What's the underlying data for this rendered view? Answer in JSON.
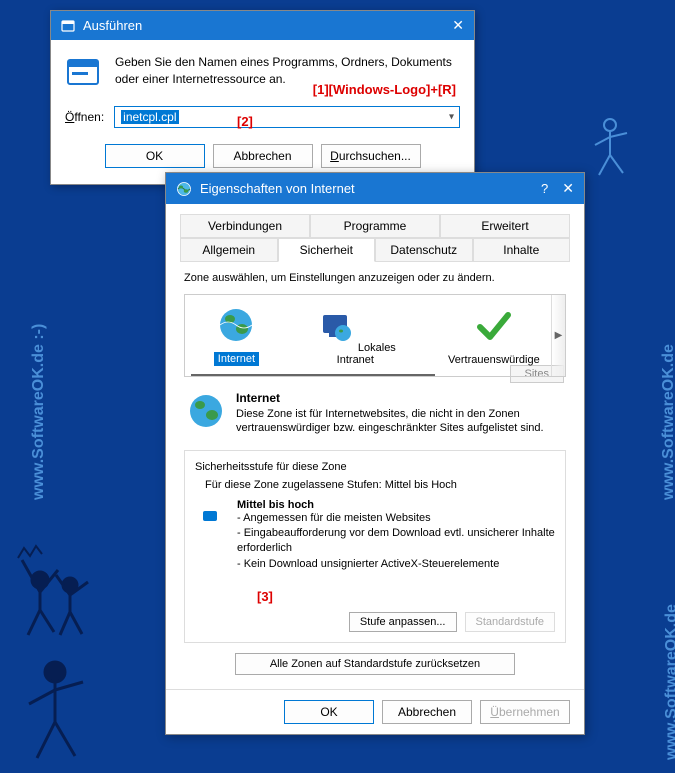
{
  "watermark": "www.SoftwareOK.de :-)",
  "run": {
    "title": "Ausführen",
    "desc": "Geben Sie den Namen eines Programms, Ordners, Dokuments oder einer Internetressource an.",
    "open_label": "Öffnen:",
    "input_value": "inetcpl.cpl",
    "ok": "OK",
    "cancel": "Abbrechen",
    "browse": "Durchsuchen...",
    "ann1": "[1][Windows-Logo]+[R]",
    "ann2": "[2]"
  },
  "inet": {
    "title": "Eigenschaften von Internet",
    "tabs_row1": [
      "Verbindungen",
      "Programme",
      "Erweitert"
    ],
    "tabs_row2": [
      "Allgemein",
      "Sicherheit",
      "Datenschutz",
      "Inhalte"
    ],
    "active_tab": "Sicherheit",
    "zone_desc": "Zone auswählen, um Einstellungen anzuzeigen oder zu ändern.",
    "zones": [
      {
        "label": "Internet",
        "selected": true
      },
      {
        "label": "Lokales Intranet",
        "selected": false
      },
      {
        "label": "Vertrauenswürdige",
        "selected": false
      }
    ],
    "sites_btn": "Sites",
    "sel_title": "Internet",
    "sel_desc": "Diese Zone ist für Internetwebsites, die nicht in den Zonen vertrauenswürdiger bzw. eingeschränkter Sites aufgelistet sind.",
    "sec_title": "Sicherheitsstufe für diese Zone",
    "sec_allowed": "Für diese Zone zugelassene Stufen: Mittel bis Hoch",
    "level_name": "Mittel bis hoch",
    "bullets": [
      "- Angemessen für die meisten Websites",
      "- Eingabeaufforderung vor dem Download evtl. unsicherer Inhalte erforderlich",
      "- Kein Download unsignierter ActiveX-Steuerelemente"
    ],
    "adjust_btn": "Stufe anpassen...",
    "default_btn": "Standardstufe",
    "reset_btn": "Alle Zonen auf Standardstufe zurücksetzen",
    "ann3": "[3]",
    "footer": {
      "ok": "OK",
      "cancel": "Abbrechen",
      "apply": "Übernehmen"
    }
  }
}
